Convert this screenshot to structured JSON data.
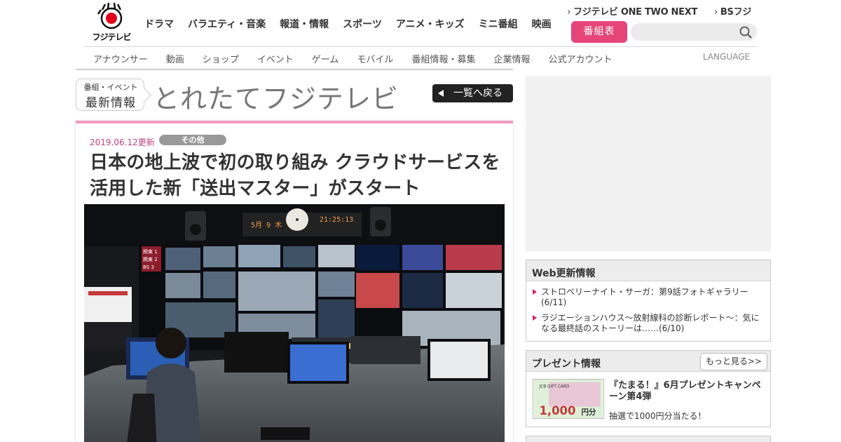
{
  "header": {
    "logo_text": "フジテレビ",
    "nav": [
      "ドラマ",
      "バラエティ・音楽",
      "報道・情報",
      "スポーツ",
      "アニメ・キッズ",
      "ミニ番組",
      "映画"
    ],
    "top_links": [
      "フジテレビ ONE TWO NEXT",
      "BSフジ"
    ],
    "guide_label": "番組表",
    "search_placeholder": "",
    "sub_nav": [
      "アナウンサー",
      "動画",
      "ショップ",
      "イベント",
      "ゲーム",
      "モバイル",
      "番組情報・募集",
      "企業情報",
      "公式アカウント"
    ],
    "language_label": "LANGUAGE",
    "accent_color": "#e6457a"
  },
  "section": {
    "badge_sub": "番組・イベント",
    "badge_main": "最新情報",
    "title": "とれたてフジテレビ",
    "back_label": "一覧へ戻る"
  },
  "article": {
    "date": "2019.06.12更新",
    "category": "その他",
    "headline": "日本の地上波で初の取り組み クラウドサービスを活用した新「送出マスター」がスタート",
    "photo_clock_date": "5月 9 木",
    "photo_clock_time": "21:25:13",
    "photo_monitor_labels": [
      "関東 1",
      "関東 2",
      "BS 3"
    ]
  },
  "sidebar": {
    "web_title": "Web更新情報",
    "web_items": [
      "ストロベリーナイト・サーガ：第9話フォトギャラリー(6/11)",
      "ラジエーションハウス～放射線科の診断レポート～：気になる最終話のストーリーは……(6/10)"
    ],
    "present_title": "プレゼント情報",
    "present_more": "もっと見る>>",
    "present_item_title": "『たまる！』6月プレゼントキャンペーン第4弾",
    "present_item_desc": "抽選で1000円分当たる！",
    "present_card_top": "JCB GIFT CARD",
    "present_card_value": "1,000",
    "present_card_unit": "円分"
  }
}
